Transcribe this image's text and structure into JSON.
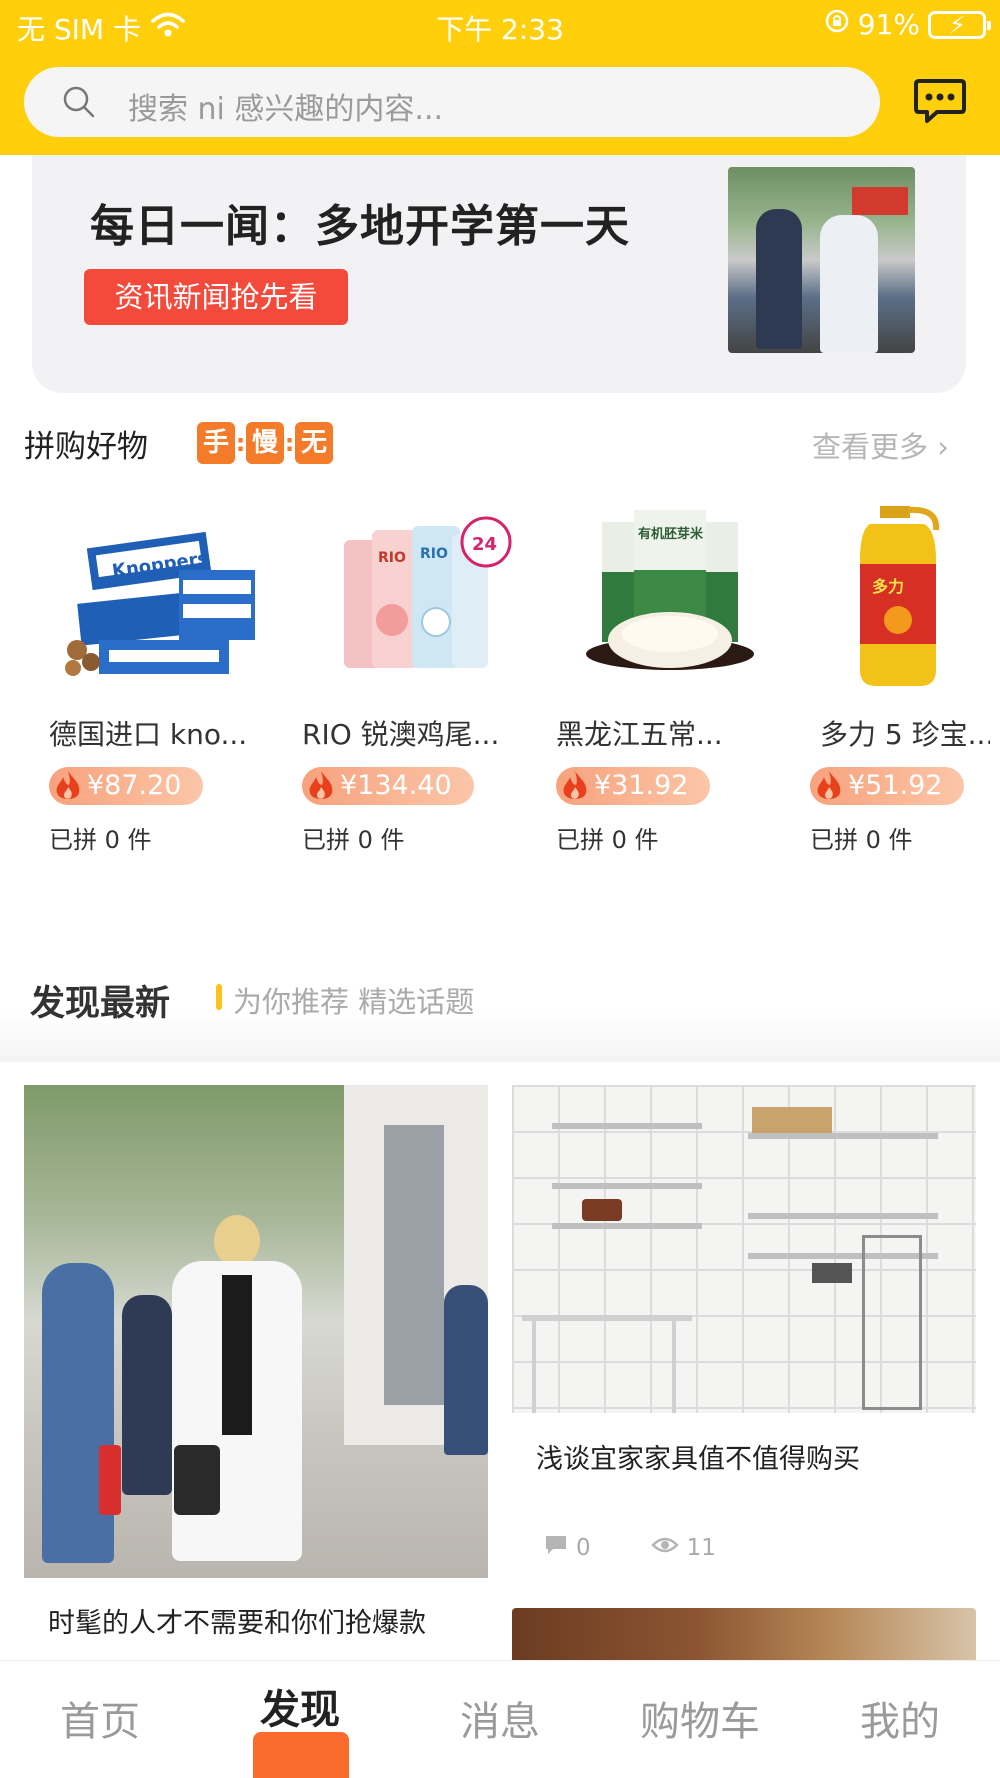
{
  "status_bar": {
    "carrier": "无 SIM 卡",
    "time": "下午 2:33",
    "battery": "91%"
  },
  "search": {
    "placeholder": "搜索 ni 感兴趣的内容..."
  },
  "icons": {
    "search": "search-icon",
    "message": "chat-bubble-icon",
    "wifi": "wifi-icon",
    "lock": "rotation-lock-icon",
    "flame": "flame-icon",
    "comment": "comment-icon",
    "eye": "eye-icon",
    "chevron": "chevron-right-icon"
  },
  "news": {
    "title": "每日一闻：多地开学第一天",
    "button": "资讯新闻抢先看"
  },
  "group_buy": {
    "title": "拼购好物",
    "badges": [
      "手",
      "慢",
      "无"
    ],
    "more": "查看更多 ›",
    "products": [
      {
        "name": "德国进口 kno...",
        "price": "¥87.20",
        "sold": "已拼 0 件"
      },
      {
        "name": "RIO 锐澳鸡尾...",
        "price": "¥134.40",
        "sold": "已拼 0 件"
      },
      {
        "name": "黑龙江五常...",
        "price": "¥31.92",
        "sold": "已拼 0 件"
      },
      {
        "name": "多力 5 珍宝...",
        "price": "¥51.92",
        "sold": "已拼 0 件"
      }
    ]
  },
  "product_image_text": {
    "p1_label": "Knoppers",
    "p2_label": "RIO",
    "p2_badge": "24",
    "p3_label": "有机胚芽米",
    "p4_label": "多力"
  },
  "discover": {
    "title": "发现最新",
    "subtitle": "为你推荐 精选话题",
    "cards": [
      {
        "title": "时髦的人才不需要和你们抢爆款"
      },
      {
        "title": "浅谈宜家家具值不值得购买",
        "comments": "0",
        "views": "11"
      }
    ]
  },
  "tabbar": {
    "tabs": [
      "首页",
      "发现",
      "消息",
      "购物车",
      "我的"
    ],
    "active": "发现"
  },
  "colors": {
    "brand_yellow": "#FFCF0B",
    "accent_orange": "#F47B2A",
    "news_red": "#F34A3B",
    "tab_indicator": "#FB6B2E"
  }
}
